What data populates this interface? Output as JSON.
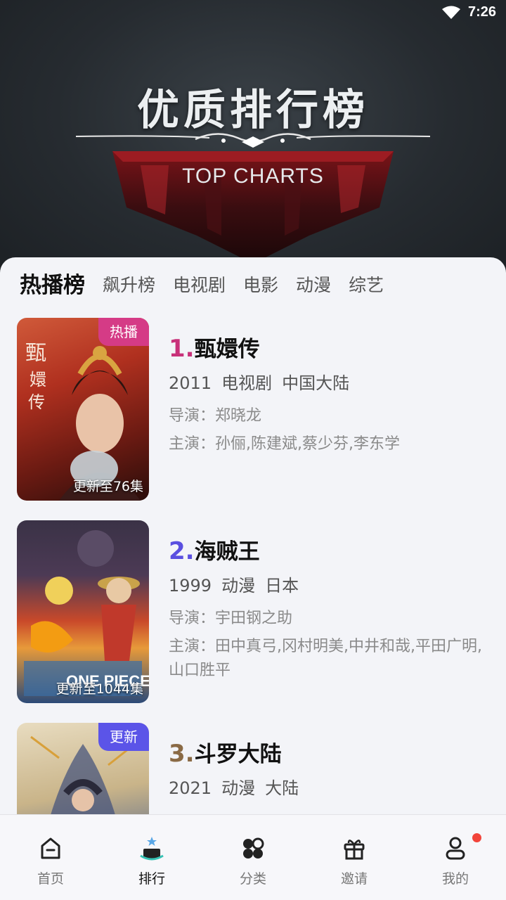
{
  "status": {
    "time": "7:26",
    "wifi_icon": "wifi-icon"
  },
  "hero": {
    "title": "优质排行榜",
    "subtitle": "TOP CHARTS"
  },
  "tabs": [
    {
      "label": "热播榜",
      "active": true
    },
    {
      "label": "飙升榜",
      "active": false
    },
    {
      "label": "电视剧",
      "active": false
    },
    {
      "label": "电影",
      "active": false
    },
    {
      "label": "动漫",
      "active": false
    },
    {
      "label": "综艺",
      "active": false
    }
  ],
  "items": [
    {
      "rank": "1.",
      "rank_color": "#c8317a",
      "title": "甄嬛传",
      "year": "2011",
      "type": "电视剧",
      "region": "中国大陆",
      "director": "导演：郑晓龙",
      "cast": "主演：孙俪,陈建斌,蔡少芬,李东学",
      "badge": "热播",
      "badge_color": "#d53b86",
      "update": "更新至76集"
    },
    {
      "rank": "2.",
      "rank_color": "#5a4fe0",
      "title": "海贼王",
      "year": "1999",
      "type": "动漫",
      "region": "日本",
      "director": "导演：宇田钢之助",
      "cast": "主演：田中真弓,冈村明美,中井和哉,平田广明,山口胜平",
      "badge": "",
      "badge_color": "",
      "update": "更新至1044集"
    },
    {
      "rank": "3.",
      "rank_color": "#8a6a45",
      "title": "斗罗大陆",
      "year": "2021",
      "type": "动漫",
      "region": "大陆",
      "director": "",
      "cast": "",
      "badge": "更新",
      "badge_color": "#5b54e8",
      "update": ""
    }
  ],
  "nav": [
    {
      "label": "首页",
      "icon": "home-icon",
      "active": false
    },
    {
      "label": "排行",
      "icon": "ranking-icon",
      "active": true
    },
    {
      "label": "分类",
      "icon": "category-icon",
      "active": false
    },
    {
      "label": "邀请",
      "icon": "gift-icon",
      "active": false
    },
    {
      "label": "我的",
      "icon": "profile-icon",
      "active": false,
      "dot_color": "#f2443a"
    }
  ]
}
